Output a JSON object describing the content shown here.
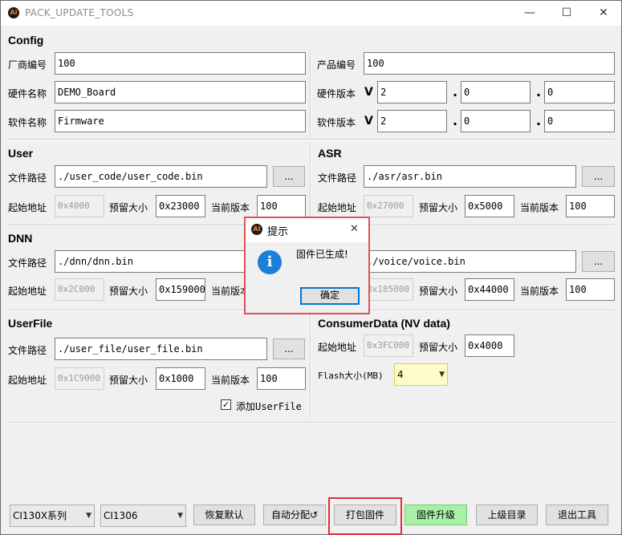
{
  "window": {
    "title": "PACK_UPDATE_TOOLS",
    "icon_text": "AI",
    "minimize_glyph": "—",
    "maximize_glyph": "☐",
    "close_glyph": "✕"
  },
  "config": {
    "title": "Config",
    "vendor_label": "厂商编号",
    "vendor_value": "100",
    "product_label": "产品编号",
    "product_value": "100",
    "hw_name_label": "硬件名称",
    "hw_name_value": "DEMO_Board",
    "hw_ver_label": "硬件版本",
    "v_glyph": "V",
    "hw_ver": [
      "2",
      "0",
      "0"
    ],
    "sw_name_label": "软件名称",
    "sw_name_value": "Firmware",
    "sw_ver_label": "软件版本",
    "sw_ver": [
      "2",
      "0",
      "0"
    ]
  },
  "user": {
    "title": "User",
    "path_label": "文件路径",
    "path_value": "./user_code/user_code.bin",
    "browse": "...",
    "addr_label": "起始地址",
    "addr_value": "0x4000",
    "size_label": "预留大小",
    "size_value": "0x23000",
    "ver_label": "当前版本",
    "ver_value": "100"
  },
  "asr": {
    "title": "ASR",
    "path_label": "文件路径",
    "path_value": "./asr/asr.bin",
    "browse": "...",
    "addr_label": "起始地址",
    "addr_value": "0x27000",
    "size_label": "预留大小",
    "size_value": "0x5000",
    "ver_label": "当前版本",
    "ver_value": "100"
  },
  "dnn": {
    "title": "DNN",
    "path_label": "文件路径",
    "path_value": "./dnn/dnn.bin",
    "addr_label": "起始地址",
    "addr_value": "0x2C000",
    "size_label": "预留大小",
    "size_value": "0x159000",
    "ver_label": "当前版本"
  },
  "voice": {
    "path_value": "./voice/voice.bin",
    "browse": "...",
    "addr_value": "0x185000",
    "size_label": "预留大小",
    "size_value": "0x44000",
    "ver_label": "当前版本",
    "ver_value": "100"
  },
  "userfile": {
    "title": "UserFile",
    "path_label": "文件路径",
    "path_value": "./user_file/user_file.bin",
    "browse": "...",
    "addr_label": "起始地址",
    "addr_value": "0x1C9000",
    "size_label": "预留大小",
    "size_value": "0x1000",
    "ver_label": "当前版本",
    "ver_value": "100",
    "add_checkbox_label": "添加UserFile",
    "add_checked": true
  },
  "consumer": {
    "title": "ConsumerData (NV data)",
    "addr_label": "起始地址",
    "addr_value": "0x3FC000",
    "size_label": "预留大小",
    "size_value": "0x4000",
    "flash_label": "Flash大小(MB)",
    "flash_value": "4"
  },
  "dialog": {
    "icon_text": "AI",
    "title": "提示",
    "close_glyph": "✕",
    "info_glyph": "i",
    "message": "固件已生成!",
    "ok_label": "确定"
  },
  "bottom": {
    "series_select": "CI130X系列",
    "chip_select": "CI1306",
    "restore_default": "恢复默认",
    "auto_allocate": "自动分配",
    "auto_allocate_icon": "↺",
    "pack_firmware": "打包固件",
    "upgrade_firmware": "固件升级",
    "parent_dir": "上级目录",
    "exit_tool": "退出工具"
  },
  "colors": {
    "highlight_red": "#e0303a",
    "upgrade_green": "#a8f0a8",
    "flash_yellow": "#fcfcc8",
    "info_blue": "#1b7fd8"
  }
}
